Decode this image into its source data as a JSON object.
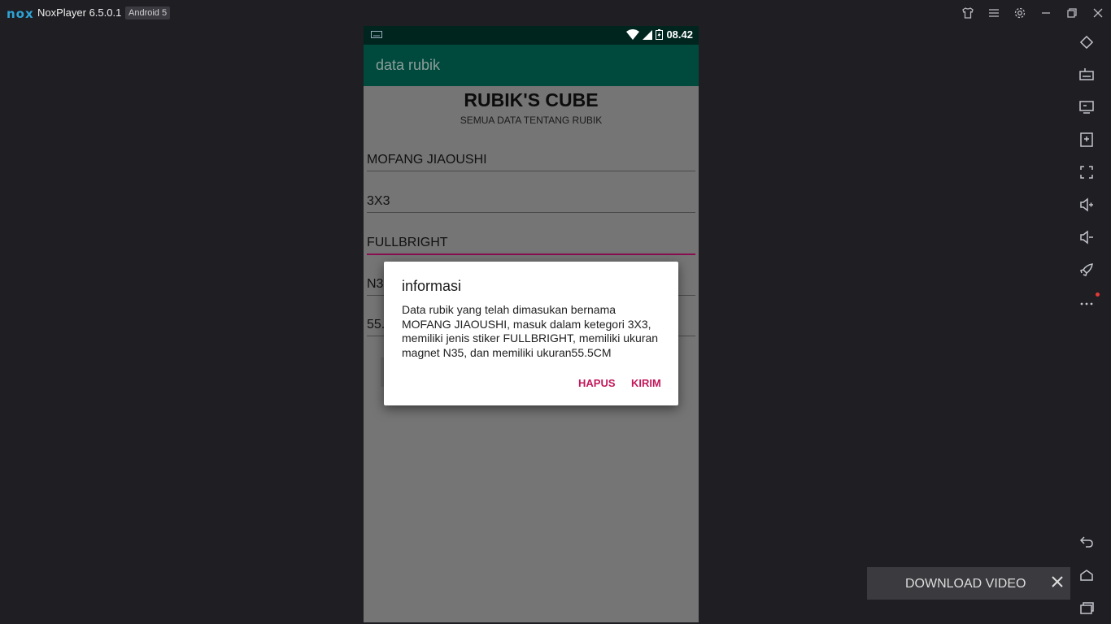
{
  "titlebar": {
    "logo": "nox",
    "app_title": "NoxPlayer 6.5.0.1",
    "android_badge": "Android 5",
    "icons": [
      "shirt-icon",
      "menu-icon",
      "gear-icon",
      "minimize-icon",
      "restore-icon",
      "close-icon"
    ]
  },
  "sidebar": {
    "icons": [
      "rotate-icon",
      "keyboard-icon",
      "screen-icon",
      "apk-install-icon",
      "fullscreen-icon",
      "volume-up-icon",
      "volume-down-icon",
      "rocket-icon",
      "more-icon",
      "back-icon",
      "home-icon",
      "recents-icon"
    ],
    "notification_color": "#e53935"
  },
  "phone": {
    "status_time": "08.42",
    "app_title": "data rubik",
    "heading": "RUBIK'S CUBE",
    "subheading": "SEMUA DATA TENTANG RUBIK",
    "fields": [
      "MOFANG JIAOUSHI",
      "3X3",
      "FULLBRIGHT",
      "N3",
      "55."
    ],
    "colors": {
      "status_bar": "#00251f",
      "app_bar": "#00493d",
      "accent": "#880e4f"
    }
  },
  "dialog": {
    "title": "informasi",
    "message": "Data rubik yang telah dimasukan bernama MOFANG JIAOUSHI, masuk dalam ketegori 3X3, memiliki jenis stiker FULLBRIGHT, memiliki ukuran magnet N35, dan memiliki ukuran55.5CM",
    "negative_button": "HAPUS",
    "positive_button": "KIRIM",
    "button_color": "#c2185b"
  },
  "toast": {
    "label": "DOWNLOAD VIDEO"
  }
}
